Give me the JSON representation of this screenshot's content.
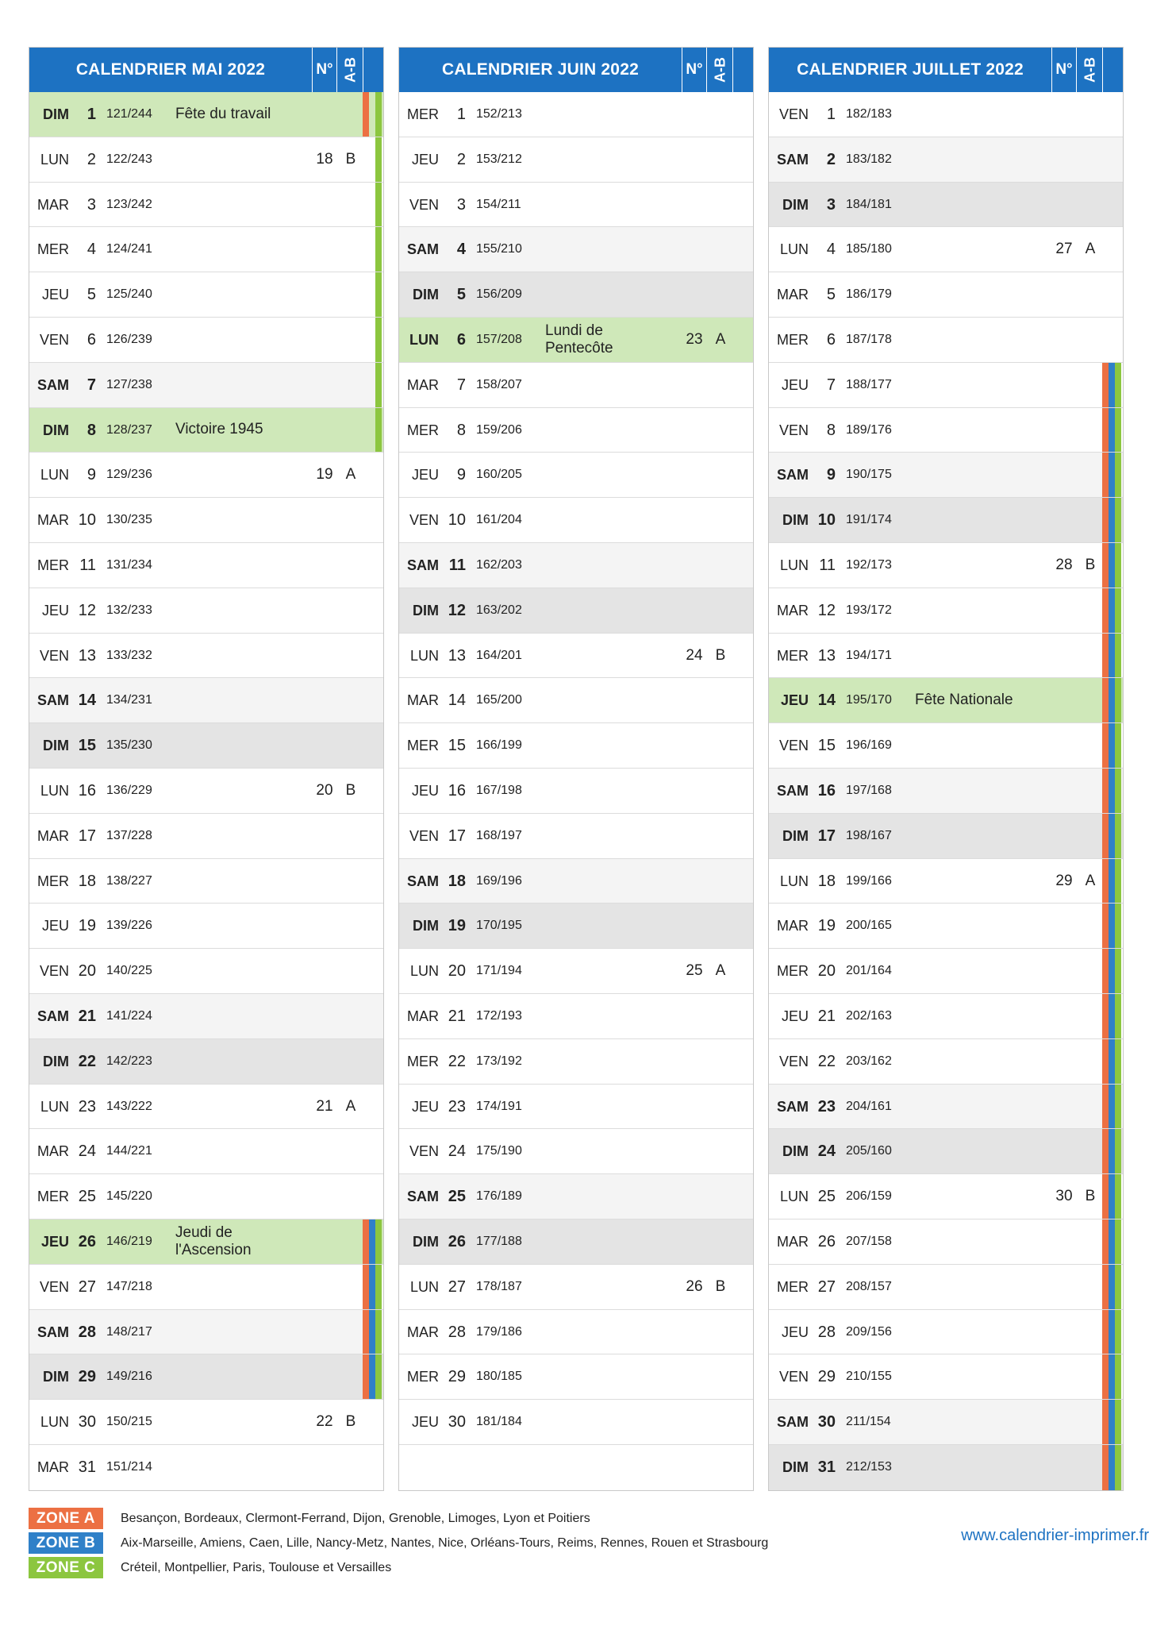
{
  "colors": {
    "header_blue": "#1d72c2",
    "holiday_green": "#cfe8b9",
    "weekend_saturday": "#f4f4f4",
    "weekend_sunday": "#e4e4e4",
    "zone_a": "#ec7043",
    "zone_b": "#2f80c8",
    "zone_c": "#8cc63f"
  },
  "months": [
    {
      "title": "CALENDRIER MAI 2022",
      "week_header": "N°",
      "ab_header": "A-B",
      "days": [
        {
          "d": "DIM",
          "n": "1",
          "o": "121/244",
          "h": "Fête du travail",
          "w": "",
          "ab": "",
          "t": "hol",
          "z": "ac"
        },
        {
          "d": "LUN",
          "n": "2",
          "o": "122/243",
          "h": "",
          "w": "18",
          "ab": "B",
          "t": "",
          "z": "c"
        },
        {
          "d": "MAR",
          "n": "3",
          "o": "123/242",
          "h": "",
          "w": "",
          "ab": "",
          "t": "",
          "z": "c"
        },
        {
          "d": "MER",
          "n": "4",
          "o": "124/241",
          "h": "",
          "w": "",
          "ab": "",
          "t": "",
          "z": "c"
        },
        {
          "d": "JEU",
          "n": "5",
          "o": "125/240",
          "h": "",
          "w": "",
          "ab": "",
          "t": "",
          "z": "c"
        },
        {
          "d": "VEN",
          "n": "6",
          "o": "126/239",
          "h": "",
          "w": "",
          "ab": "",
          "t": "",
          "z": "c"
        },
        {
          "d": "SAM",
          "n": "7",
          "o": "127/238",
          "h": "",
          "w": "",
          "ab": "",
          "t": "sat",
          "z": "c"
        },
        {
          "d": "DIM",
          "n": "8",
          "o": "128/237",
          "h": "Victoire 1945",
          "w": "",
          "ab": "",
          "t": "hol",
          "z": "c"
        },
        {
          "d": "LUN",
          "n": "9",
          "o": "129/236",
          "h": "",
          "w": "19",
          "ab": "A",
          "t": "",
          "z": ""
        },
        {
          "d": "MAR",
          "n": "10",
          "o": "130/235",
          "h": "",
          "w": "",
          "ab": "",
          "t": "",
          "z": ""
        },
        {
          "d": "MER",
          "n": "11",
          "o": "131/234",
          "h": "",
          "w": "",
          "ab": "",
          "t": "",
          "z": ""
        },
        {
          "d": "JEU",
          "n": "12",
          "o": "132/233",
          "h": "",
          "w": "",
          "ab": "",
          "t": "",
          "z": ""
        },
        {
          "d": "VEN",
          "n": "13",
          "o": "133/232",
          "h": "",
          "w": "",
          "ab": "",
          "t": "",
          "z": ""
        },
        {
          "d": "SAM",
          "n": "14",
          "o": "134/231",
          "h": "",
          "w": "",
          "ab": "",
          "t": "sat",
          "z": ""
        },
        {
          "d": "DIM",
          "n": "15",
          "o": "135/230",
          "h": "",
          "w": "",
          "ab": "",
          "t": "sun",
          "z": ""
        },
        {
          "d": "LUN",
          "n": "16",
          "o": "136/229",
          "h": "",
          "w": "20",
          "ab": "B",
          "t": "",
          "z": ""
        },
        {
          "d": "MAR",
          "n": "17",
          "o": "137/228",
          "h": "",
          "w": "",
          "ab": "",
          "t": "",
          "z": ""
        },
        {
          "d": "MER",
          "n": "18",
          "o": "138/227",
          "h": "",
          "w": "",
          "ab": "",
          "t": "",
          "z": ""
        },
        {
          "d": "JEU",
          "n": "19",
          "o": "139/226",
          "h": "",
          "w": "",
          "ab": "",
          "t": "",
          "z": ""
        },
        {
          "d": "VEN",
          "n": "20",
          "o": "140/225",
          "h": "",
          "w": "",
          "ab": "",
          "t": "",
          "z": ""
        },
        {
          "d": "SAM",
          "n": "21",
          "o": "141/224",
          "h": "",
          "w": "",
          "ab": "",
          "t": "sat",
          "z": ""
        },
        {
          "d": "DIM",
          "n": "22",
          "o": "142/223",
          "h": "",
          "w": "",
          "ab": "",
          "t": "sun",
          "z": ""
        },
        {
          "d": "LUN",
          "n": "23",
          "o": "143/222",
          "h": "",
          "w": "21",
          "ab": "A",
          "t": "",
          "z": ""
        },
        {
          "d": "MAR",
          "n": "24",
          "o": "144/221",
          "h": "",
          "w": "",
          "ab": "",
          "t": "",
          "z": ""
        },
        {
          "d": "MER",
          "n": "25",
          "o": "145/220",
          "h": "",
          "w": "",
          "ab": "",
          "t": "",
          "z": ""
        },
        {
          "d": "JEU",
          "n": "26",
          "o": "146/219",
          "h": "Jeudi de l'Ascension",
          "w": "",
          "ab": "",
          "t": "hol",
          "z": "abc"
        },
        {
          "d": "VEN",
          "n": "27",
          "o": "147/218",
          "h": "",
          "w": "",
          "ab": "",
          "t": "",
          "z": "abc"
        },
        {
          "d": "SAM",
          "n": "28",
          "o": "148/217",
          "h": "",
          "w": "",
          "ab": "",
          "t": "sat",
          "z": "abc"
        },
        {
          "d": "DIM",
          "n": "29",
          "o": "149/216",
          "h": "",
          "w": "",
          "ab": "",
          "t": "sun",
          "z": "abc"
        },
        {
          "d": "LUN",
          "n": "30",
          "o": "150/215",
          "h": "",
          "w": "22",
          "ab": "B",
          "t": "",
          "z": ""
        },
        {
          "d": "MAR",
          "n": "31",
          "o": "151/214",
          "h": "",
          "w": "",
          "ab": "",
          "t": "",
          "z": ""
        }
      ]
    },
    {
      "title": "CALENDRIER JUIN 2022",
      "week_header": "N°",
      "ab_header": "A-B",
      "days": [
        {
          "d": "MER",
          "n": "1",
          "o": "152/213",
          "h": "",
          "w": "",
          "ab": "",
          "t": "",
          "z": ""
        },
        {
          "d": "JEU",
          "n": "2",
          "o": "153/212",
          "h": "",
          "w": "",
          "ab": "",
          "t": "",
          "z": ""
        },
        {
          "d": "VEN",
          "n": "3",
          "o": "154/211",
          "h": "",
          "w": "",
          "ab": "",
          "t": "",
          "z": ""
        },
        {
          "d": "SAM",
          "n": "4",
          "o": "155/210",
          "h": "",
          "w": "",
          "ab": "",
          "t": "sat",
          "z": ""
        },
        {
          "d": "DIM",
          "n": "5",
          "o": "156/209",
          "h": "",
          "w": "",
          "ab": "",
          "t": "sun",
          "z": ""
        },
        {
          "d": "LUN",
          "n": "6",
          "o": "157/208",
          "h": "Lundi de Pentecôte",
          "w": "23",
          "ab": "A",
          "t": "hol",
          "z": ""
        },
        {
          "d": "MAR",
          "n": "7",
          "o": "158/207",
          "h": "",
          "w": "",
          "ab": "",
          "t": "",
          "z": ""
        },
        {
          "d": "MER",
          "n": "8",
          "o": "159/206",
          "h": "",
          "w": "",
          "ab": "",
          "t": "",
          "z": ""
        },
        {
          "d": "JEU",
          "n": "9",
          "o": "160/205",
          "h": "",
          "w": "",
          "ab": "",
          "t": "",
          "z": ""
        },
        {
          "d": "VEN",
          "n": "10",
          "o": "161/204",
          "h": "",
          "w": "",
          "ab": "",
          "t": "",
          "z": ""
        },
        {
          "d": "SAM",
          "n": "11",
          "o": "162/203",
          "h": "",
          "w": "",
          "ab": "",
          "t": "sat",
          "z": ""
        },
        {
          "d": "DIM",
          "n": "12",
          "o": "163/202",
          "h": "",
          "w": "",
          "ab": "",
          "t": "sun",
          "z": ""
        },
        {
          "d": "LUN",
          "n": "13",
          "o": "164/201",
          "h": "",
          "w": "24",
          "ab": "B",
          "t": "",
          "z": ""
        },
        {
          "d": "MAR",
          "n": "14",
          "o": "165/200",
          "h": "",
          "w": "",
          "ab": "",
          "t": "",
          "z": ""
        },
        {
          "d": "MER",
          "n": "15",
          "o": "166/199",
          "h": "",
          "w": "",
          "ab": "",
          "t": "",
          "z": ""
        },
        {
          "d": "JEU",
          "n": "16",
          "o": "167/198",
          "h": "",
          "w": "",
          "ab": "",
          "t": "",
          "z": ""
        },
        {
          "d": "VEN",
          "n": "17",
          "o": "168/197",
          "h": "",
          "w": "",
          "ab": "",
          "t": "",
          "z": ""
        },
        {
          "d": "SAM",
          "n": "18",
          "o": "169/196",
          "h": "",
          "w": "",
          "ab": "",
          "t": "sat",
          "z": ""
        },
        {
          "d": "DIM",
          "n": "19",
          "o": "170/195",
          "h": "",
          "w": "",
          "ab": "",
          "t": "sun",
          "z": ""
        },
        {
          "d": "LUN",
          "n": "20",
          "o": "171/194",
          "h": "",
          "w": "25",
          "ab": "A",
          "t": "",
          "z": ""
        },
        {
          "d": "MAR",
          "n": "21",
          "o": "172/193",
          "h": "",
          "w": "",
          "ab": "",
          "t": "",
          "z": ""
        },
        {
          "d": "MER",
          "n": "22",
          "o": "173/192",
          "h": "",
          "w": "",
          "ab": "",
          "t": "",
          "z": ""
        },
        {
          "d": "JEU",
          "n": "23",
          "o": "174/191",
          "h": "",
          "w": "",
          "ab": "",
          "t": "",
          "z": ""
        },
        {
          "d": "VEN",
          "n": "24",
          "o": "175/190",
          "h": "",
          "w": "",
          "ab": "",
          "t": "",
          "z": ""
        },
        {
          "d": "SAM",
          "n": "25",
          "o": "176/189",
          "h": "",
          "w": "",
          "ab": "",
          "t": "sat",
          "z": ""
        },
        {
          "d": "DIM",
          "n": "26",
          "o": "177/188",
          "h": "",
          "w": "",
          "ab": "",
          "t": "sun",
          "z": ""
        },
        {
          "d": "LUN",
          "n": "27",
          "o": "178/187",
          "h": "",
          "w": "26",
          "ab": "B",
          "t": "",
          "z": ""
        },
        {
          "d": "MAR",
          "n": "28",
          "o": "179/186",
          "h": "",
          "w": "",
          "ab": "",
          "t": "",
          "z": ""
        },
        {
          "d": "MER",
          "n": "29",
          "o": "180/185",
          "h": "",
          "w": "",
          "ab": "",
          "t": "",
          "z": ""
        },
        {
          "d": "JEU",
          "n": "30",
          "o": "181/184",
          "h": "",
          "w": "",
          "ab": "",
          "t": "",
          "z": ""
        }
      ]
    },
    {
      "title": "CALENDRIER JUILLET 2022",
      "week_header": "N°",
      "ab_header": "A-B",
      "days": [
        {
          "d": "VEN",
          "n": "1",
          "o": "182/183",
          "h": "",
          "w": "",
          "ab": "",
          "t": "",
          "z": ""
        },
        {
          "d": "SAM",
          "n": "2",
          "o": "183/182",
          "h": "",
          "w": "",
          "ab": "",
          "t": "sat",
          "z": ""
        },
        {
          "d": "DIM",
          "n": "3",
          "o": "184/181",
          "h": "",
          "w": "",
          "ab": "",
          "t": "sun",
          "z": ""
        },
        {
          "d": "LUN",
          "n": "4",
          "o": "185/180",
          "h": "",
          "w": "27",
          "ab": "A",
          "t": "",
          "z": ""
        },
        {
          "d": "MAR",
          "n": "5",
          "o": "186/179",
          "h": "",
          "w": "",
          "ab": "",
          "t": "",
          "z": ""
        },
        {
          "d": "MER",
          "n": "6",
          "o": "187/178",
          "h": "",
          "w": "",
          "ab": "",
          "t": "",
          "z": ""
        },
        {
          "d": "JEU",
          "n": "7",
          "o": "188/177",
          "h": "",
          "w": "",
          "ab": "",
          "t": "",
          "z": "abc"
        },
        {
          "d": "VEN",
          "n": "8",
          "o": "189/176",
          "h": "",
          "w": "",
          "ab": "",
          "t": "",
          "z": "abc"
        },
        {
          "d": "SAM",
          "n": "9",
          "o": "190/175",
          "h": "",
          "w": "",
          "ab": "",
          "t": "sat",
          "z": "abc"
        },
        {
          "d": "DIM",
          "n": "10",
          "o": "191/174",
          "h": "",
          "w": "",
          "ab": "",
          "t": "sun",
          "z": "abc"
        },
        {
          "d": "LUN",
          "n": "11",
          "o": "192/173",
          "h": "",
          "w": "28",
          "ab": "B",
          "t": "",
          "z": "abc"
        },
        {
          "d": "MAR",
          "n": "12",
          "o": "193/172",
          "h": "",
          "w": "",
          "ab": "",
          "t": "",
          "z": "abc"
        },
        {
          "d": "MER",
          "n": "13",
          "o": "194/171",
          "h": "",
          "w": "",
          "ab": "",
          "t": "",
          "z": "abc"
        },
        {
          "d": "JEU",
          "n": "14",
          "o": "195/170",
          "h": "Fête Nationale",
          "w": "",
          "ab": "",
          "t": "hol",
          "z": "abc"
        },
        {
          "d": "VEN",
          "n": "15",
          "o": "196/169",
          "h": "",
          "w": "",
          "ab": "",
          "t": "",
          "z": "abc"
        },
        {
          "d": "SAM",
          "n": "16",
          "o": "197/168",
          "h": "",
          "w": "",
          "ab": "",
          "t": "sat",
          "z": "abc"
        },
        {
          "d": "DIM",
          "n": "17",
          "o": "198/167",
          "h": "",
          "w": "",
          "ab": "",
          "t": "sun",
          "z": "abc"
        },
        {
          "d": "LUN",
          "n": "18",
          "o": "199/166",
          "h": "",
          "w": "29",
          "ab": "A",
          "t": "",
          "z": "abc"
        },
        {
          "d": "MAR",
          "n": "19",
          "o": "200/165",
          "h": "",
          "w": "",
          "ab": "",
          "t": "",
          "z": "abc"
        },
        {
          "d": "MER",
          "n": "20",
          "o": "201/164",
          "h": "",
          "w": "",
          "ab": "",
          "t": "",
          "z": "abc"
        },
        {
          "d": "JEU",
          "n": "21",
          "o": "202/163",
          "h": "",
          "w": "",
          "ab": "",
          "t": "",
          "z": "abc"
        },
        {
          "d": "VEN",
          "n": "22",
          "o": "203/162",
          "h": "",
          "w": "",
          "ab": "",
          "t": "",
          "z": "abc"
        },
        {
          "d": "SAM",
          "n": "23",
          "o": "204/161",
          "h": "",
          "w": "",
          "ab": "",
          "t": "sat",
          "z": "abc"
        },
        {
          "d": "DIM",
          "n": "24",
          "o": "205/160",
          "h": "",
          "w": "",
          "ab": "",
          "t": "sun",
          "z": "abc"
        },
        {
          "d": "LUN",
          "n": "25",
          "o": "206/159",
          "h": "",
          "w": "30",
          "ab": "B",
          "t": "",
          "z": "abc"
        },
        {
          "d": "MAR",
          "n": "26",
          "o": "207/158",
          "h": "",
          "w": "",
          "ab": "",
          "t": "",
          "z": "abc"
        },
        {
          "d": "MER",
          "n": "27",
          "o": "208/157",
          "h": "",
          "w": "",
          "ab": "",
          "t": "",
          "z": "abc"
        },
        {
          "d": "JEU",
          "n": "28",
          "o": "209/156",
          "h": "",
          "w": "",
          "ab": "",
          "t": "",
          "z": "abc"
        },
        {
          "d": "VEN",
          "n": "29",
          "o": "210/155",
          "h": "",
          "w": "",
          "ab": "",
          "t": "",
          "z": "abc"
        },
        {
          "d": "SAM",
          "n": "30",
          "o": "211/154",
          "h": "",
          "w": "",
          "ab": "",
          "t": "sat",
          "z": "abc"
        },
        {
          "d": "DIM",
          "n": "31",
          "o": "212/153",
          "h": "",
          "w": "",
          "ab": "",
          "t": "sun",
          "z": "abc"
        }
      ]
    }
  ],
  "legend": [
    {
      "label": "ZONE A",
      "text": "Besançon, Bordeaux, Clermont-Ferrand, Dijon, Grenoble, Limoges, Lyon et Poitiers"
    },
    {
      "label": "ZONE B",
      "text": "Aix-Marseille, Amiens, Caen, Lille, Nancy-Metz, Nantes, Nice, Orléans-Tours, Reims, Rennes, Rouen et Strasbourg"
    },
    {
      "label": "ZONE C",
      "text": "Créteil, Montpellier, Paris, Toulouse et Versailles"
    }
  ],
  "website": "www.calendrier-imprimer.fr"
}
